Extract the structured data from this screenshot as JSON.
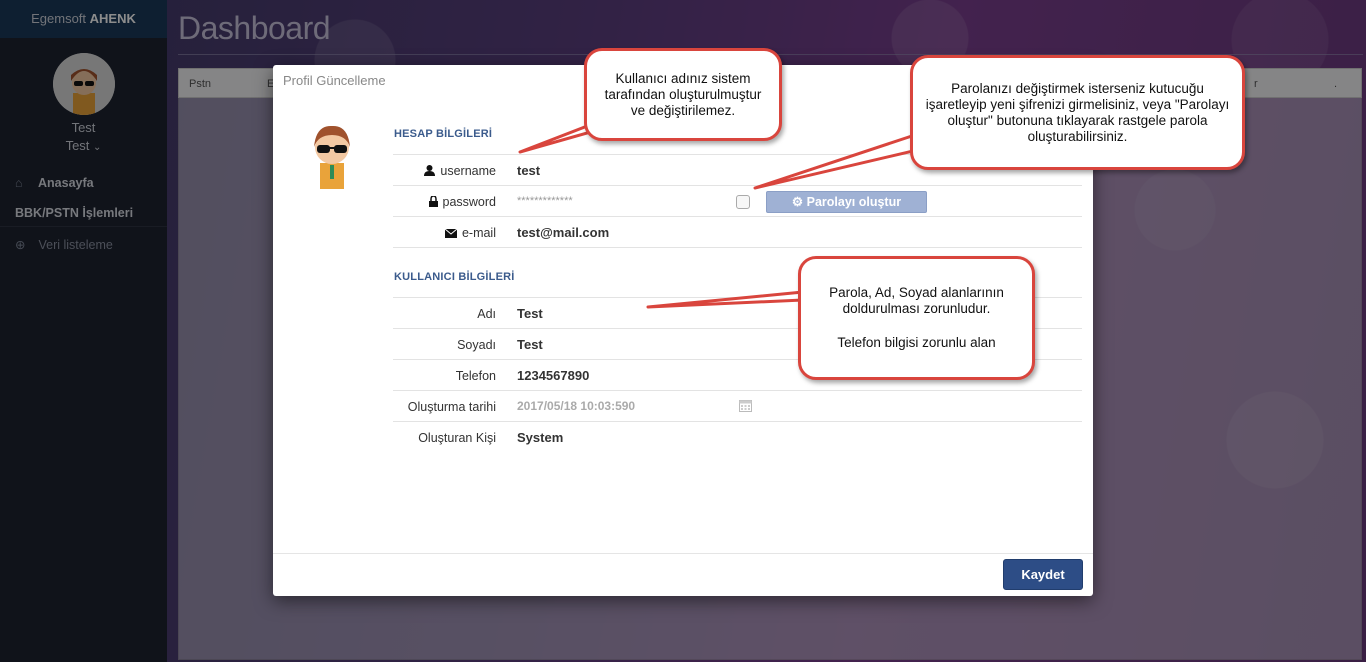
{
  "sidebar": {
    "brand_prefix": "Egemsoft",
    "brand_name": "AHENK",
    "user_name": "Test",
    "user_menu": "Test",
    "items": [
      {
        "label": "Anasayfa"
      },
      {
        "label": "BBK/PSTN İşlemleri"
      },
      {
        "label": "Veri listeleme"
      }
    ]
  },
  "main": {
    "title": "Dashboard",
    "table_headers": [
      "Pstn",
      "E",
      "r",
      "."
    ]
  },
  "modal": {
    "title": "Profil Güncelleme",
    "account_section": "HESAP BİLGİLERİ",
    "user_section": "KULLANICI BİLGİLERİ",
    "fields": {
      "username_label": "username",
      "username_value": "test",
      "password_label": "password",
      "password_value": "*************",
      "email_label": "e-mail",
      "email_value": "test@mail.com",
      "name_label": "Adı",
      "name_value": "Test",
      "surname_label": "Soyadı",
      "surname_value": "Test",
      "phone_label": "Telefon",
      "phone_value": "1234567890",
      "created_label": "Oluşturma tarihi",
      "created_value": "2017/05/18 10:03:590",
      "creator_label": "Oluşturan Kişi",
      "creator_value": "System"
    },
    "generate_button": "Parolayı oluştur",
    "save_button": "Kaydet"
  },
  "callouts": {
    "username_note": "Kullanıcı adınız sistem tarafından oluşturulmuştur ve değiştirilemez.",
    "password_note": "Parolanızı değiştirmek isterseniz kutucuğu işaretleyip yeni şifrenizi girmelisiniz, veya \"Parolayı oluştur\" butonuna tıklayarak rastgele parola oluşturabilirsiniz.",
    "required_note": "Parola, Ad, Soyad alanlarının doldurulması zorunludur.",
    "phone_note": "Telefon bilgisi zorunlu alan"
  },
  "colors": {
    "accent": "#2d4d86",
    "callout_border": "#d9453d",
    "section_title": "#3b5b8c"
  }
}
